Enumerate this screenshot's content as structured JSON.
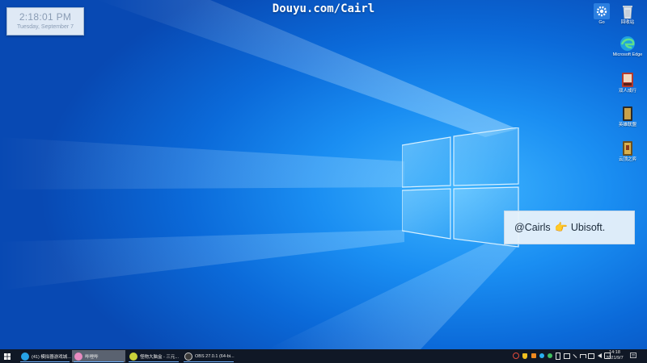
{
  "stream_title": "Douyu.com/Cairl",
  "clock_widget": {
    "time": "2:18:01 PM",
    "date": "Tuesday, September 7"
  },
  "desktop_icons": [
    {
      "name": "gear-app",
      "label": "Go",
      "icon": "gear-icon",
      "color": "#2b7fe0"
    },
    {
      "name": "recycle-bin",
      "label": "回收站",
      "icon": "recycle-bin-icon",
      "color": "#cfd8e3"
    },
    {
      "name": "microsoft-edge",
      "label": "Microsoft Edge",
      "icon": "edge-icon",
      "color": "#1fa1e0"
    },
    {
      "name": "game-1",
      "label": "双人成行",
      "icon": "game-icon",
      "color": "#b33b2f"
    },
    {
      "name": "game-2",
      "label": "英雄联盟",
      "icon": "game-icon",
      "color": "#c9a14a"
    },
    {
      "name": "game-3",
      "label": "云顶之弈",
      "icon": "game-icon",
      "color": "#d6b04f"
    }
  ],
  "overlay_card": {
    "handle": "@Cairls",
    "hand_glyph": "👉",
    "brand": "Ubisoft."
  },
  "taskbar": {
    "start_icon": "windows-start-icon",
    "items": [
      {
        "label": "(41) 模拟器游戏城...",
        "icon": "edge-icon",
        "color": "#27a3e6",
        "active": false
      },
      {
        "label": "哔哩哔",
        "icon": "bilibili-icon",
        "color": "#e88bc0",
        "active": true
      },
      {
        "label": "怪物大脑盒 - 三元...",
        "icon": "app-icon",
        "color": "#c9d23a",
        "active": false
      },
      {
        "label": "OBS 27.0.1 (64-bi...",
        "icon": "obs-icon",
        "color": "#3a3a3a",
        "active": false
      }
    ],
    "tray_icons": [
      {
        "icon": "warning-icon",
        "color": "#e04a3a"
      },
      {
        "icon": "shield-icon",
        "color": "#f0c020"
      },
      {
        "icon": "app-icon",
        "color": "#f08a20"
      },
      {
        "icon": "app-icon",
        "color": "#2ab0f0"
      },
      {
        "icon": "app-icon",
        "color": "#40c060"
      },
      {
        "icon": "battery-icon",
        "color": "#e0e0e0"
      },
      {
        "icon": "app-icon",
        "color": "#e0e0e0"
      },
      {
        "icon": "tools-icon",
        "color": "#e0e0e0"
      },
      {
        "icon": "network-icon",
        "color": "#e0e0e0"
      },
      {
        "icon": "display-icon",
        "color": "#e0e0e0"
      },
      {
        "icon": "speaker-icon",
        "color": "#e0e0e0"
      },
      {
        "icon": "ime-icon",
        "color": "#e0e0e0"
      }
    ],
    "clock": {
      "time": "14:18",
      "date": "2021/9/7"
    },
    "notification_icon": "notification-icon"
  }
}
